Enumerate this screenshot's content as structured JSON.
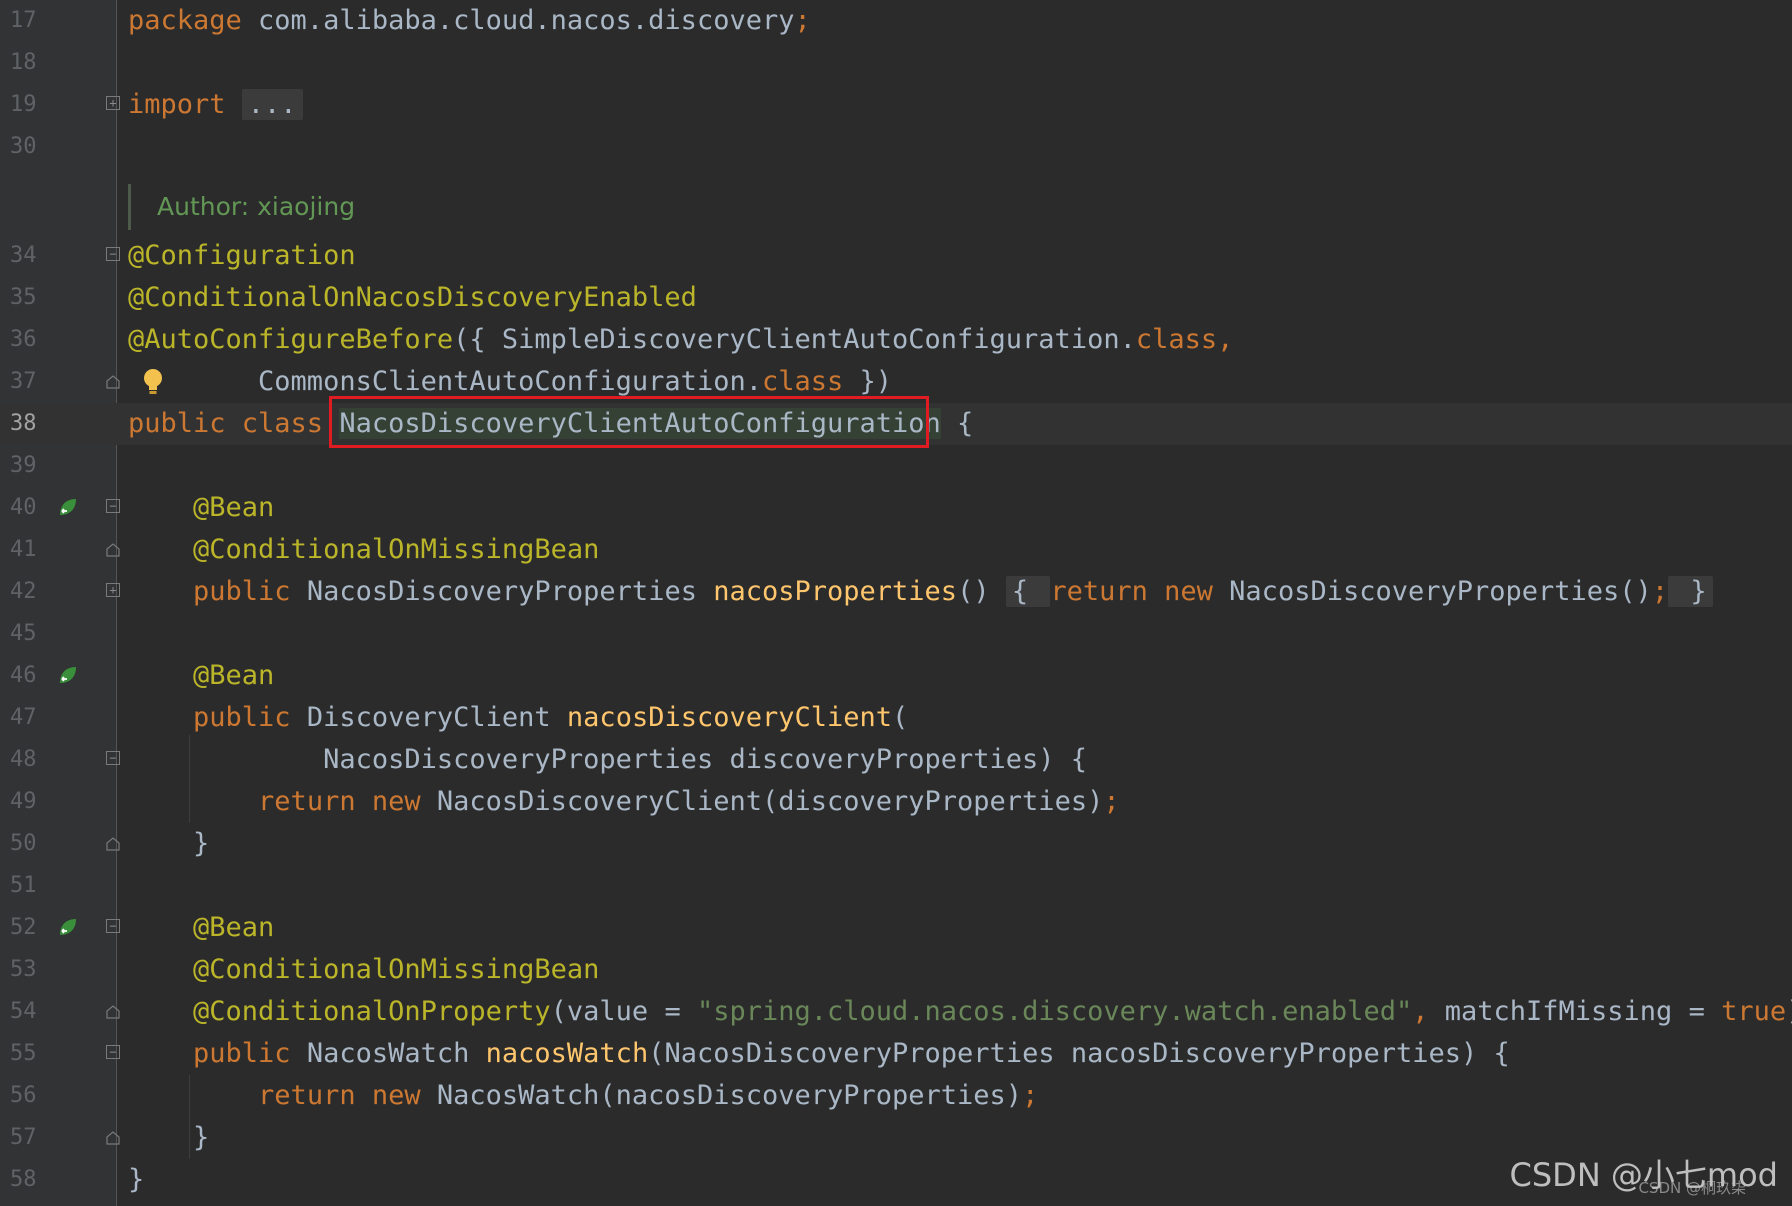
{
  "editor": {
    "lines": [
      {
        "n": "17",
        "tokens": [
          {
            "t": "package ",
            "c": "kw"
          },
          {
            "t": "com.alibaba.cloud.nacos.discovery",
            "c": "plain"
          },
          {
            "t": ";",
            "c": "kw"
          }
        ]
      },
      {
        "n": "18",
        "tokens": []
      },
      {
        "n": "19",
        "tokens": [
          {
            "t": "import ",
            "c": "kw"
          },
          {
            "t": "...",
            "c": "collapsed"
          }
        ]
      },
      {
        "n": "30",
        "tokens": []
      },
      {
        "n": "34",
        "tokens": [
          {
            "t": "@Configuration",
            "c": "ann"
          }
        ]
      },
      {
        "n": "35",
        "tokens": [
          {
            "t": "@ConditionalOnNacosDiscoveryEnabled",
            "c": "ann"
          }
        ]
      },
      {
        "n": "36",
        "tokens": [
          {
            "t": "@AutoConfigureBefore",
            "c": "ann"
          },
          {
            "t": "({ SimpleDiscoveryClientAutoConfiguration.",
            "c": "plain"
          },
          {
            "t": "class",
            "c": "kw"
          },
          {
            "t": ",",
            "c": "kw"
          }
        ]
      },
      {
        "n": "37",
        "tokens": [
          {
            "t": "        CommonsClientAutoConfiguration.",
            "c": "plain"
          },
          {
            "t": "class",
            "c": "kw"
          },
          {
            "t": " })",
            "c": "plain"
          }
        ]
      },
      {
        "n": "38",
        "tokens": [
          {
            "t": "public class ",
            "c": "kw"
          },
          {
            "t": "NacosDiscoveryClientAutoConfiguration",
            "c": "sel"
          },
          {
            "t": " {",
            "c": "plain"
          }
        ]
      },
      {
        "n": "39",
        "tokens": []
      },
      {
        "n": "40",
        "tokens": [
          {
            "t": "    ",
            "c": "plain"
          },
          {
            "t": "@Bean",
            "c": "ann"
          }
        ]
      },
      {
        "n": "41",
        "tokens": [
          {
            "t": "    ",
            "c": "plain"
          },
          {
            "t": "@ConditionalOnMissingBean",
            "c": "ann"
          }
        ]
      },
      {
        "n": "42",
        "tokens": [
          {
            "t": "    ",
            "c": "plain"
          },
          {
            "t": "public ",
            "c": "kw"
          },
          {
            "t": "NacosDiscoveryProperties ",
            "c": "plain"
          },
          {
            "t": "nacosProperties",
            "c": "fn"
          },
          {
            "t": "() ",
            "c": "plain"
          },
          {
            "t": "{ ",
            "c": "collapsed"
          },
          {
            "t": "return new ",
            "c": "kw"
          },
          {
            "t": "NacosDiscoveryProperties()",
            "c": "plain"
          },
          {
            "t": ";",
            "c": "kw"
          },
          {
            "t": " }",
            "c": "collapsed"
          }
        ]
      },
      {
        "n": "45",
        "tokens": []
      },
      {
        "n": "46",
        "tokens": [
          {
            "t": "    ",
            "c": "plain"
          },
          {
            "t": "@Bean",
            "c": "ann"
          }
        ]
      },
      {
        "n": "47",
        "tokens": [
          {
            "t": "    ",
            "c": "plain"
          },
          {
            "t": "public ",
            "c": "kw"
          },
          {
            "t": "DiscoveryClient ",
            "c": "plain"
          },
          {
            "t": "nacosDiscoveryClient",
            "c": "fn"
          },
          {
            "t": "(",
            "c": "plain"
          }
        ]
      },
      {
        "n": "48",
        "tokens": [
          {
            "t": "            NacosDiscoveryProperties discoveryProperties) {",
            "c": "plain"
          }
        ]
      },
      {
        "n": "49",
        "tokens": [
          {
            "t": "        ",
            "c": "plain"
          },
          {
            "t": "return new ",
            "c": "kw"
          },
          {
            "t": "NacosDiscoveryClient(discoveryProperties)",
            "c": "plain"
          },
          {
            "t": ";",
            "c": "kw"
          }
        ]
      },
      {
        "n": "50",
        "tokens": [
          {
            "t": "    }",
            "c": "plain"
          }
        ]
      },
      {
        "n": "51",
        "tokens": []
      },
      {
        "n": "52",
        "tokens": [
          {
            "t": "    ",
            "c": "plain"
          },
          {
            "t": "@Bean",
            "c": "ann"
          }
        ]
      },
      {
        "n": "53",
        "tokens": [
          {
            "t": "    ",
            "c": "plain"
          },
          {
            "t": "@ConditionalOnMissingBean",
            "c": "ann"
          }
        ]
      },
      {
        "n": "54",
        "tokens": [
          {
            "t": "    ",
            "c": "plain"
          },
          {
            "t": "@ConditionalOnProperty",
            "c": "ann"
          },
          {
            "t": "(value = ",
            "c": "plain"
          },
          {
            "t": "\"spring.cloud.nacos.discovery.watch.enabled\"",
            "c": "str"
          },
          {
            "t": ", ",
            "c": "kw"
          },
          {
            "t": "matchIfMissing = ",
            "c": "plain"
          },
          {
            "t": "true",
            "c": "kw"
          },
          {
            "t": ")",
            "c": "plain"
          }
        ]
      },
      {
        "n": "55",
        "tokens": [
          {
            "t": "    ",
            "c": "plain"
          },
          {
            "t": "public ",
            "c": "kw"
          },
          {
            "t": "NacosWatch ",
            "c": "plain"
          },
          {
            "t": "nacosWatch",
            "c": "fn"
          },
          {
            "t": "(NacosDiscoveryProperties nacosDiscoveryProperties) {",
            "c": "plain"
          }
        ]
      },
      {
        "n": "56",
        "tokens": [
          {
            "t": "        ",
            "c": "plain"
          },
          {
            "t": "return new ",
            "c": "kw"
          },
          {
            "t": "NacosWatch(nacosDiscoveryProperties)",
            "c": "plain"
          },
          {
            "t": ";",
            "c": "kw"
          }
        ]
      },
      {
        "n": "57",
        "tokens": [
          {
            "t": "    }",
            "c": "plain"
          }
        ]
      },
      {
        "n": "58",
        "tokens": [
          {
            "t": "}",
            "c": "plain"
          }
        ]
      }
    ],
    "doc_comment": "Author: xiaojing",
    "current_line": "38"
  },
  "watermark": {
    "main": "CSDN @小七mod",
    "small": "CSDN @桐玖柒"
  },
  "colors": {
    "background": "#2b2b2b",
    "gutter": "#313335",
    "keyword": "#cc7832",
    "annotation": "#bbb529",
    "method": "#ffc66d",
    "string": "#6a8759",
    "text": "#a9b7c6",
    "doc_comment": "#629755",
    "highlight_box": "#e01b22"
  }
}
